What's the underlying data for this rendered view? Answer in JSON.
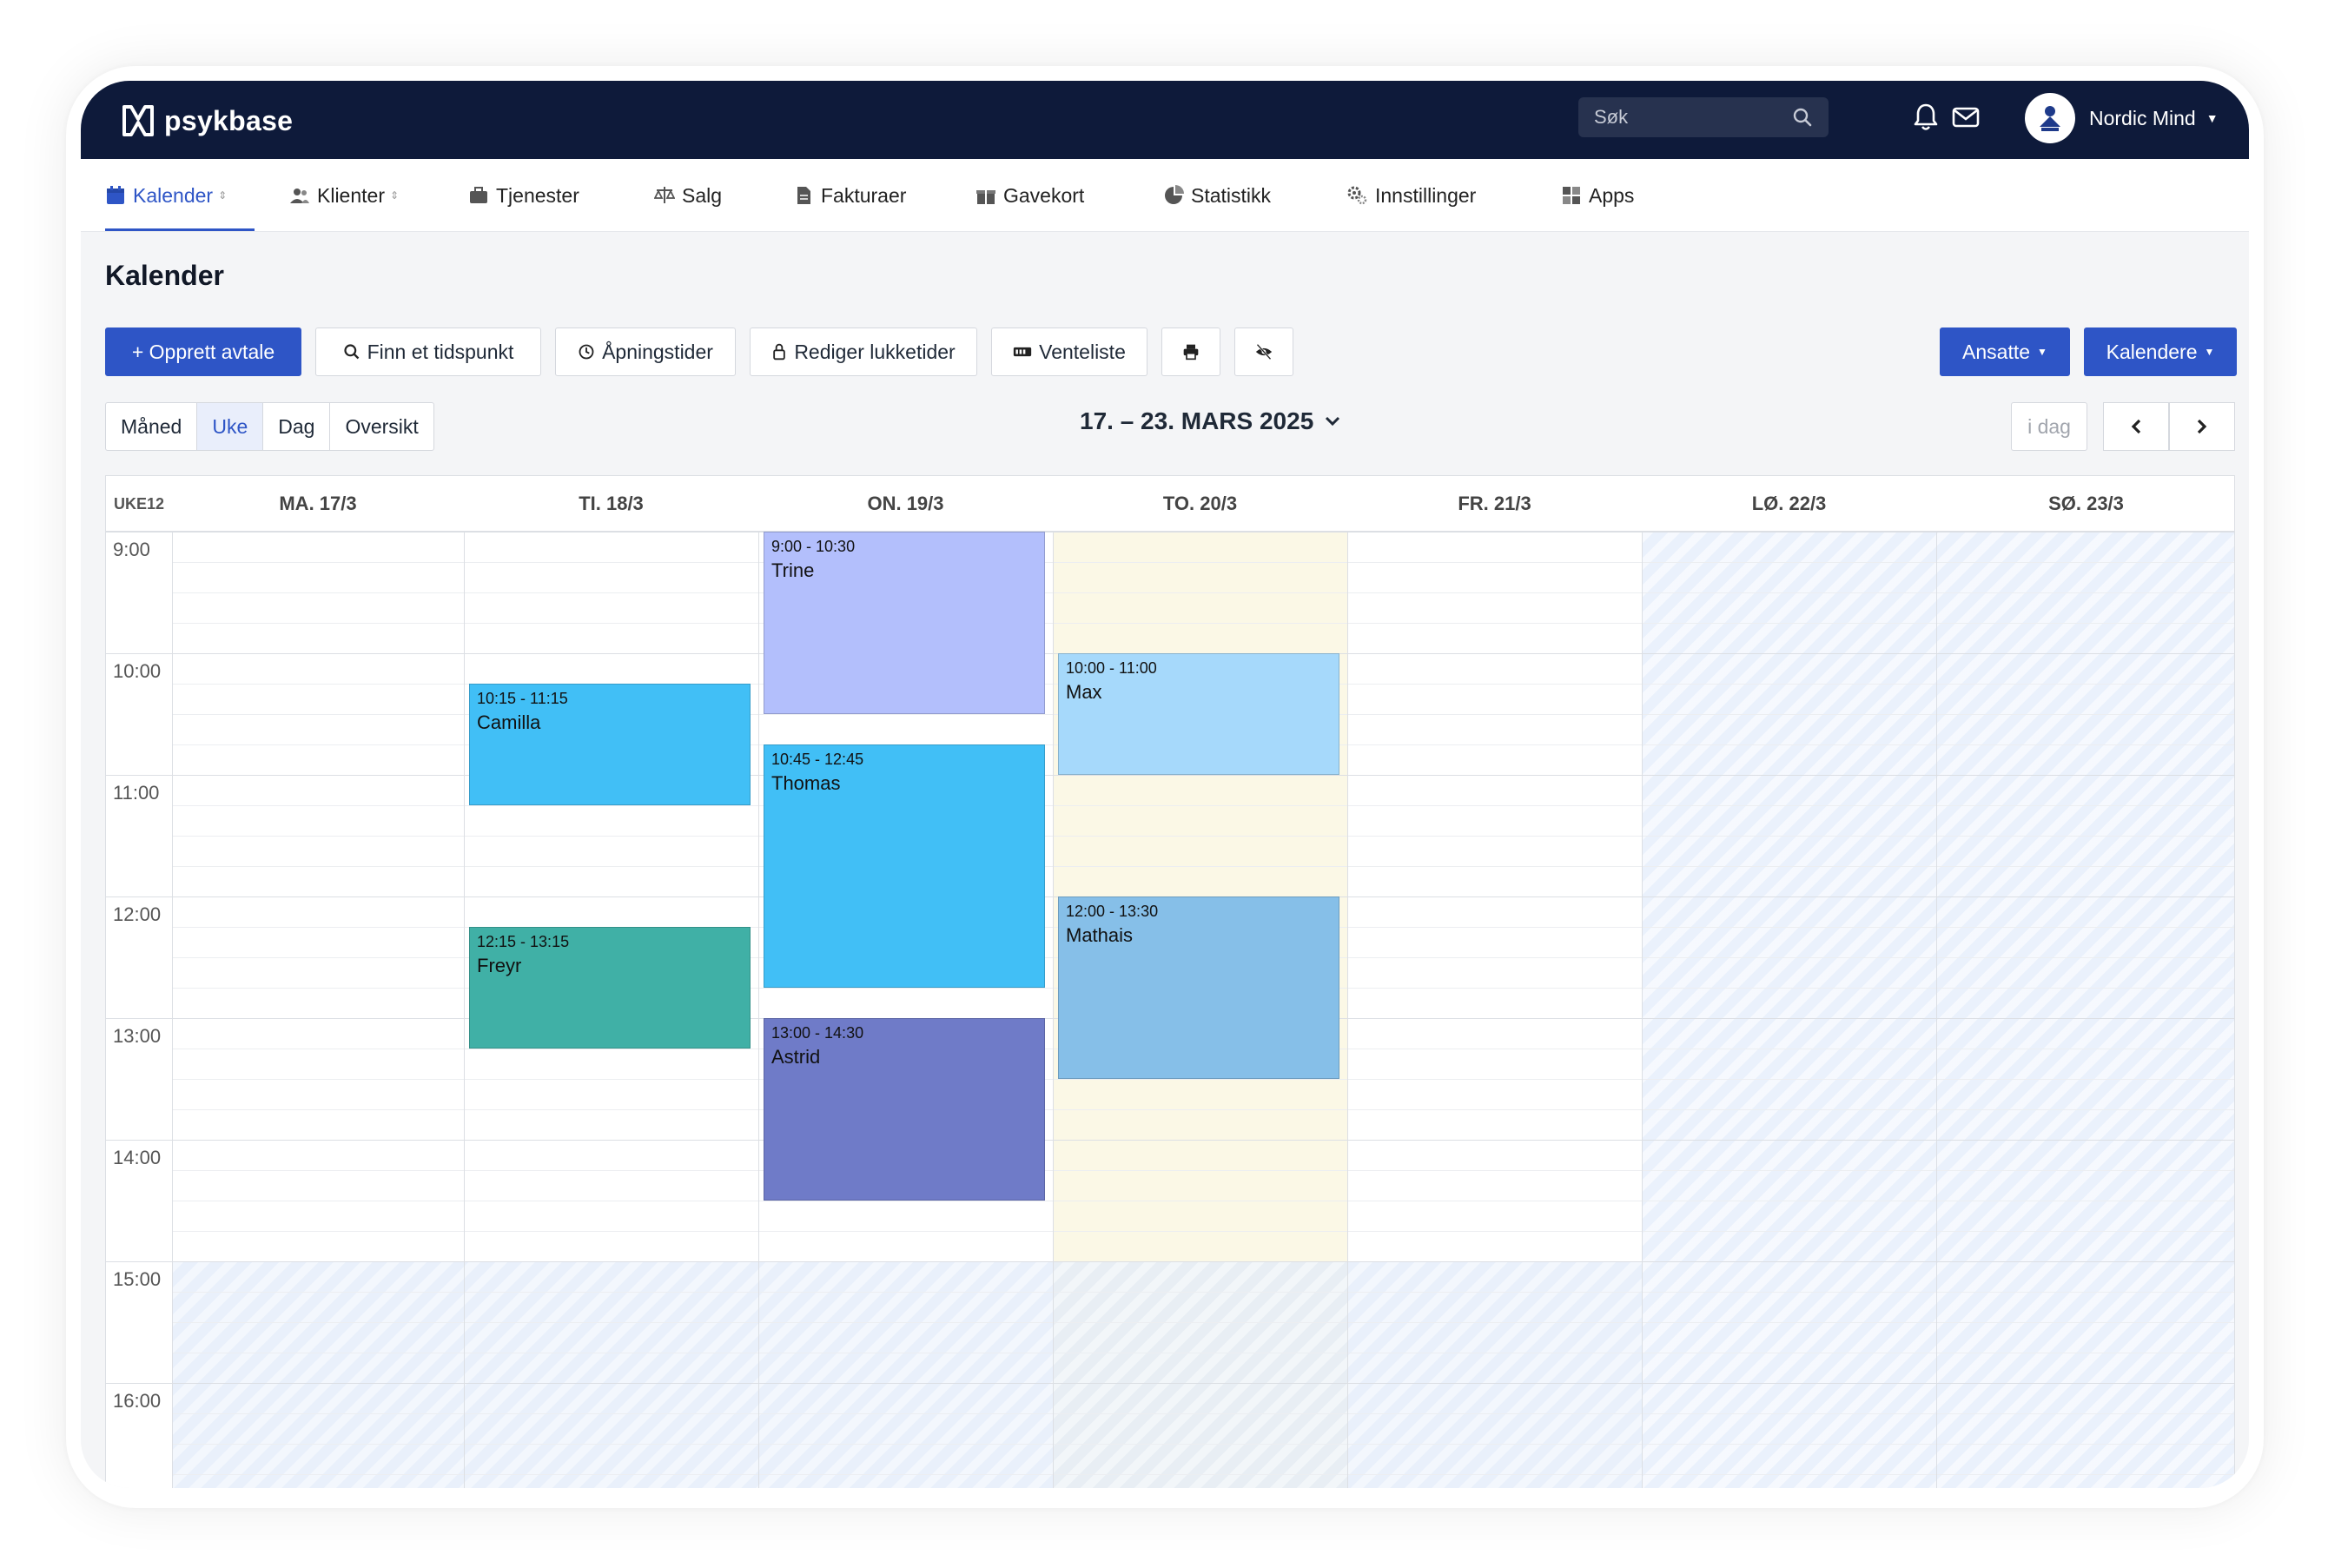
{
  "brand": {
    "name": "psykbase"
  },
  "topbar": {
    "search_placeholder": "Søk",
    "user_name": "Nordic Mind"
  },
  "nav": {
    "items": [
      {
        "label": "Kalender",
        "icon": "calendar-icon"
      },
      {
        "label": "Klienter",
        "icon": "users-icon"
      },
      {
        "label": "Tjenester",
        "icon": "briefcase-icon"
      },
      {
        "label": "Salg",
        "icon": "scale-icon"
      },
      {
        "label": "Fakturaer",
        "icon": "invoice-icon"
      },
      {
        "label": "Gavekort",
        "icon": "gift-icon"
      },
      {
        "label": "Statistikk",
        "icon": "pie-chart-icon"
      },
      {
        "label": "Innstillinger",
        "icon": "cogs-icon"
      },
      {
        "label": "Apps",
        "icon": "grid-icon"
      }
    ]
  },
  "page": {
    "title": "Kalender"
  },
  "toolbar": {
    "create": "+ Opprett avtale",
    "find": "Finn et tidspunkt",
    "hours": "Åpningstider",
    "closing": "Rediger lukketider",
    "waitlist": "Venteliste",
    "staff": "Ansatte",
    "calendars": "Kalendere"
  },
  "views": {
    "month": "Måned",
    "week": "Uke",
    "day": "Dag",
    "overview": "Oversikt",
    "active": "Uke"
  },
  "range": {
    "label": "17. – 23. MARS 2025",
    "today": "i dag"
  },
  "calendar": {
    "week_label": "UKE12",
    "days": [
      "MA. 17/3",
      "TI. 18/3",
      "ON. 19/3",
      "TO. 20/3",
      "FR. 21/3",
      "LØ. 22/3",
      "SØ. 23/3"
    ],
    "hours": [
      "9:00",
      "10:00",
      "11:00",
      "12:00",
      "13:00",
      "14:00",
      "15:00",
      "16:00"
    ],
    "events": [
      {
        "time": "10:15 - 11:15",
        "name": "Camilla",
        "color": "#41bff6"
      },
      {
        "time": "12:15 - 13:15",
        "name": "Freyr",
        "color": "#40b0a6"
      },
      {
        "time": "9:00 - 10:30",
        "name": "Trine",
        "color": "#b3bffc"
      },
      {
        "time": "10:45 - 12:45",
        "name": "Thomas",
        "color": "#41bff6"
      },
      {
        "time": "13:00 - 14:30",
        "name": "Astrid",
        "color": "#6f7bc8"
      },
      {
        "time": "10:00 - 11:00",
        "name": "Max",
        "color": "#a6d9fb"
      },
      {
        "time": "12:00 - 13:30",
        "name": "Mathais",
        "color": "#86bfe8"
      }
    ]
  },
  "colors": {
    "topbar": "#0e1a3a",
    "accent": "#2e55c6"
  }
}
